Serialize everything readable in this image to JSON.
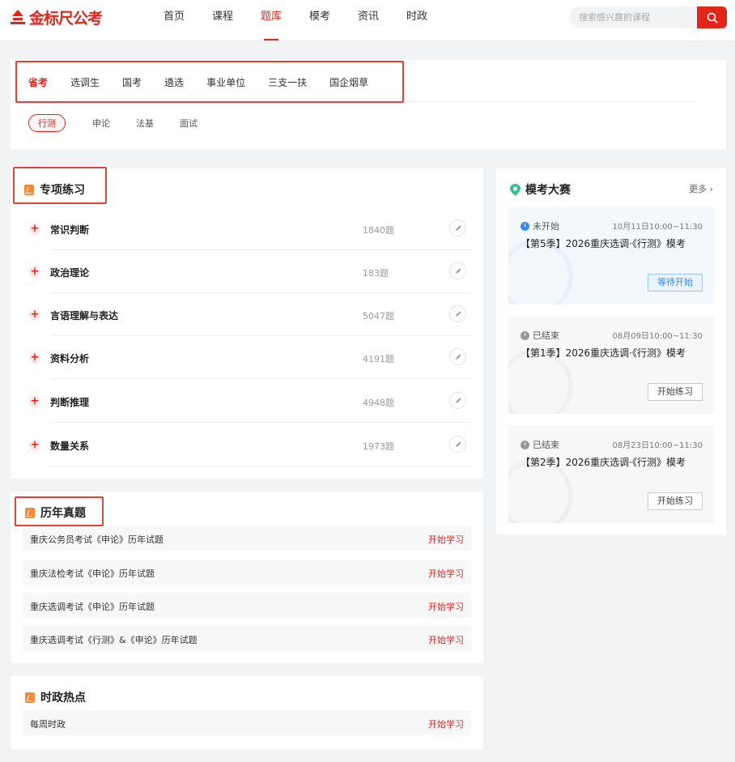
{
  "header": {
    "logo_text": "金标尺公考",
    "nav": [
      "首页",
      "课程",
      "题库",
      "模考",
      "资讯",
      "时政"
    ],
    "active_nav": "题库",
    "search_placeholder": "搜索感兴趣的课程"
  },
  "categories": [
    "省考",
    "选调生",
    "国考",
    "遴选",
    "事业单位",
    "三支一扶",
    "国企烟草"
  ],
  "active_category": "省考",
  "subjects": [
    "行测",
    "申论",
    "法基",
    "面试"
  ],
  "active_subject": "行测",
  "practice": {
    "title": "专项练习",
    "items": [
      {
        "name": "常识判断",
        "count": "1840题"
      },
      {
        "name": "政治理论",
        "count": "183题"
      },
      {
        "name": "言语理解与表达",
        "count": "5047题"
      },
      {
        "name": "资料分析",
        "count": "4191题"
      },
      {
        "name": "判断推理",
        "count": "4948题"
      },
      {
        "name": "数量关系",
        "count": "1973题"
      }
    ]
  },
  "past_exams": {
    "title": "历年真题",
    "items": [
      {
        "name": "重庆公务员考试《申论》历年试题",
        "action": "开始学习"
      },
      {
        "name": "重庆法检考试《申论》历年试题",
        "action": "开始学习"
      },
      {
        "name": "重庆选调考试《申论》历年试题",
        "action": "开始学习"
      },
      {
        "name": "重庆选调考试《行测》&《申论》历年试题",
        "action": "开始学习"
      }
    ]
  },
  "hot": {
    "title": "时政热点",
    "items": [
      {
        "name": "每周时政",
        "action": "开始学习"
      }
    ]
  },
  "contest": {
    "title": "模考大赛",
    "more": "更多 ›",
    "cards": [
      {
        "status": "未开始",
        "time": "10月11日10:00~11:30",
        "name": "【第5季】2026重庆选调·《行测》模考",
        "button": "等待开始",
        "state": "upcoming",
        "status_color": "#3a8bf0"
      },
      {
        "status": "已结束",
        "time": "08月09日10:00~11:30",
        "name": "【第1季】2026重庆选调·《行测》模考",
        "button": "开始练习",
        "state": "ended",
        "status_color": "#999999"
      },
      {
        "status": "已结束",
        "time": "08月23日10:00~11:30",
        "name": "【第2季】2026重庆选调·《行测》模考",
        "button": "开始练习",
        "state": "ended",
        "status_color": "#999999"
      }
    ]
  },
  "colors": {
    "accent": "#e1251b",
    "highlight_box": "#e0443a",
    "info_blue": "#3a8bf0"
  }
}
